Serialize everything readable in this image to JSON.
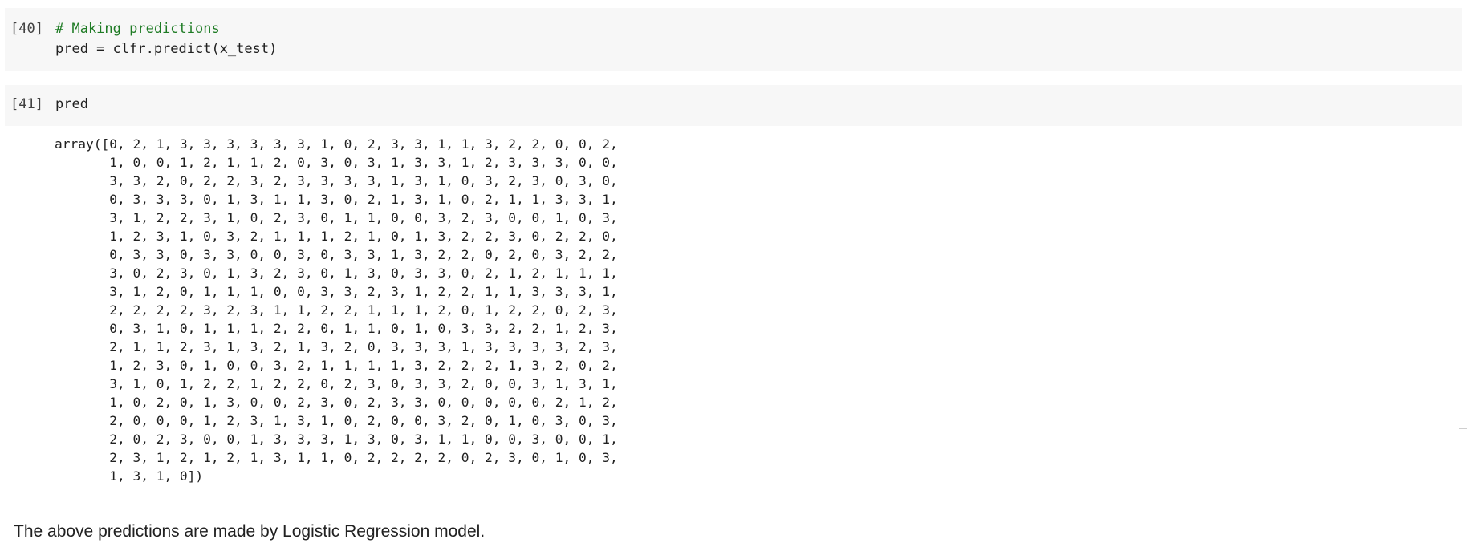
{
  "cells": [
    {
      "exec_count": "[40]",
      "comment": "# Making predictions",
      "code": "pred = clfr.predict(x_test)"
    },
    {
      "exec_count": "[41]",
      "code": "pred"
    }
  ],
  "output_lines": [
    "array([0, 2, 1, 3, 3, 3, 3, 3, 3, 1, 0, 2, 3, 3, 1, 1, 3, 2, 2, 0, 0, 2,",
    "       1, 0, 0, 1, 2, 1, 1, 2, 0, 3, 0, 3, 1, 3, 3, 1, 2, 3, 3, 3, 0, 0,",
    "       3, 3, 2, 0, 2, 2, 3, 2, 3, 3, 3, 3, 1, 3, 1, 0, 3, 2, 3, 0, 3, 0,",
    "       0, 3, 3, 3, 0, 1, 3, 1, 1, 3, 0, 2, 1, 3, 1, 0, 2, 1, 1, 3, 3, 1,",
    "       3, 1, 2, 2, 3, 1, 0, 2, 3, 0, 1, 1, 0, 0, 3, 2, 3, 0, 0, 1, 0, 3,",
    "       1, 2, 3, 1, 0, 3, 2, 1, 1, 1, 2, 1, 0, 1, 3, 2, 2, 3, 0, 2, 2, 0,",
    "       0, 3, 3, 0, 3, 3, 0, 0, 3, 0, 3, 3, 1, 3, 2, 2, 0, 2, 0, 3, 2, 2,",
    "       3, 0, 2, 3, 0, 1, 3, 2, 3, 0, 1, 3, 0, 3, 3, 0, 2, 1, 2, 1, 1, 1,",
    "       3, 1, 2, 0, 1, 1, 1, 0, 0, 3, 3, 2, 3, 1, 2, 2, 1, 1, 3, 3, 3, 1,",
    "       2, 2, 2, 2, 3, 2, 3, 1, 1, 2, 2, 1, 1, 1, 2, 0, 1, 2, 2, 0, 2, 3,",
    "       0, 3, 1, 0, 1, 1, 1, 2, 2, 0, 1, 1, 0, 1, 0, 3, 3, 2, 2, 1, 2, 3,",
    "       2, 1, 1, 2, 3, 1, 3, 2, 1, 3, 2, 0, 3, 3, 3, 1, 3, 3, 3, 3, 2, 3,",
    "       1, 2, 3, 0, 1, 0, 0, 3, 2, 1, 1, 1, 1, 3, 2, 2, 2, 1, 3, 2, 0, 2,",
    "       3, 1, 0, 1, 2, 2, 1, 2, 2, 0, 2, 3, 0, 3, 3, 2, 0, 0, 3, 1, 3, 1,",
    "       1, 0, 2, 0, 1, 3, 0, 0, 2, 3, 0, 2, 3, 3, 0, 0, 0, 0, 0, 2, 1, 2,",
    "       2, 0, 0, 0, 1, 2, 3, 1, 3, 1, 0, 2, 0, 0, 3, 2, 0, 1, 0, 3, 0, 3,",
    "       2, 0, 2, 3, 0, 0, 1, 3, 3, 3, 1, 3, 0, 3, 1, 1, 0, 0, 3, 0, 0, 1,",
    "       2, 3, 1, 2, 1, 2, 1, 3, 1, 1, 0, 2, 2, 2, 2, 0, 2, 3, 0, 1, 0, 3,",
    "       1, 3, 1, 0])"
  ],
  "markdown": "The above predictions are made by Logistic Regression model.",
  "colors": {
    "cell_background": "#f7f7f7",
    "comment": "#1e7b24",
    "text": "#212121"
  }
}
